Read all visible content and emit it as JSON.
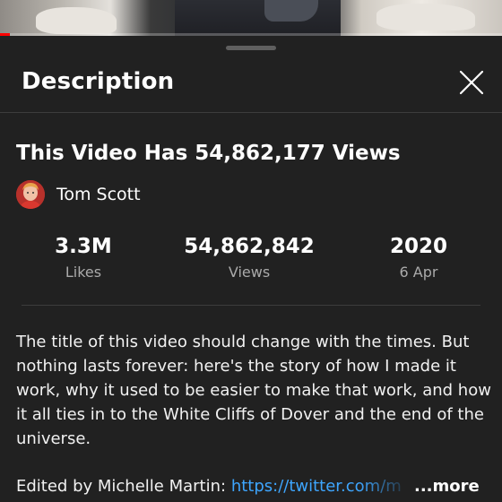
{
  "video_player": {
    "progress_fraction": 0.02,
    "progress_color": "#ff0000"
  },
  "sheet": {
    "title": "Description",
    "close_icon": "close-icon"
  },
  "video": {
    "title": "This Video Has 54,862,177 Views",
    "channel": {
      "name": "Tom Scott",
      "avatar_icon": "avatar"
    }
  },
  "stats": [
    {
      "value": "3.3M",
      "label": "Likes"
    },
    {
      "value": "54,862,842",
      "label": "Views"
    },
    {
      "value": "2020",
      "label": "6 Apr"
    }
  ],
  "description": {
    "text": "The title of this video should change with the times. But nothing lasts forever: here's the story of how I made it work, why it used to be easier to make that work, and how it all ties in to the White Cliffs of Dover and the end of the universe.",
    "edited_prefix": "Edited by Michelle Martin: ",
    "edited_link": "https://twitter.com/m",
    "more_label": "...more"
  },
  "colors": {
    "background": "#212121",
    "link": "#3ea6ff",
    "secondary_text": "#aaaaaa"
  }
}
